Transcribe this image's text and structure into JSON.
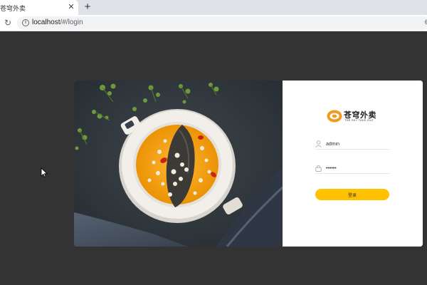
{
  "browser": {
    "tab_title": "苍穹外卖",
    "close_tab_symbol": "✕",
    "new_tab_symbol": "+",
    "url_host": "localhost",
    "url_path": "/#/login"
  },
  "login": {
    "brand_cn": "苍穹外卖",
    "brand_en": "THE SKY TAKE-OUT",
    "username_value": "admin",
    "password_value": "123456",
    "submit_label": "登录"
  },
  "colors": {
    "page_background": "#333333",
    "accent": "#ffc200",
    "card_background": "#ffffff"
  },
  "icons": {
    "reload": "reload-icon",
    "site_info": "info-icon",
    "user": "user-icon",
    "lock": "lock-icon",
    "tab_close": "close-icon",
    "new_tab": "plus-icon"
  }
}
